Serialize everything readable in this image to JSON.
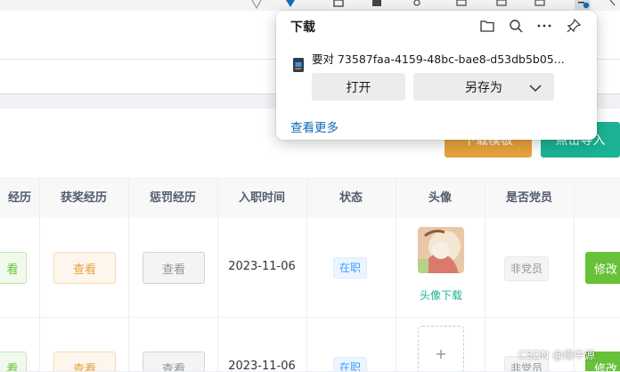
{
  "download_popup": {
    "title": "下载",
    "file_name": "要对 73587faa-4159-48bc-bae8-d53db5b05...",
    "open_label": "打开",
    "save_as_label": "另存为",
    "see_more_label": "查看更多",
    "icons": [
      "folder-icon",
      "search-icon",
      "more-icon",
      "pin-icon"
    ]
  },
  "toolbar": {
    "download_template_label": "下载模板",
    "import_label": "点击导入"
  },
  "table": {
    "headers": [
      "经历",
      "获奖经历",
      "惩罚经历",
      "入职时间",
      "状态",
      "头像",
      "是否党员"
    ],
    "rows": [
      {
        "view1": "看",
        "view2": "查看",
        "view3": "查看",
        "date": "2023-11-06",
        "status": "在职",
        "avatar_download": "头像下载",
        "party": "非党员",
        "edit": "修改"
      },
      {
        "view1": "看",
        "view2": "查看",
        "view3": "查看",
        "date": "2023-11-06",
        "status": "在职",
        "upload_plus": "+",
        "party": "非党员",
        "edit": "修改"
      }
    ]
  },
  "watermark": "CSDN @缘中源",
  "colors": {
    "orange": "#e6a23c",
    "teal": "#1bb394",
    "link": "#0f6cbd",
    "edge_blue": "#0f6cbd"
  }
}
